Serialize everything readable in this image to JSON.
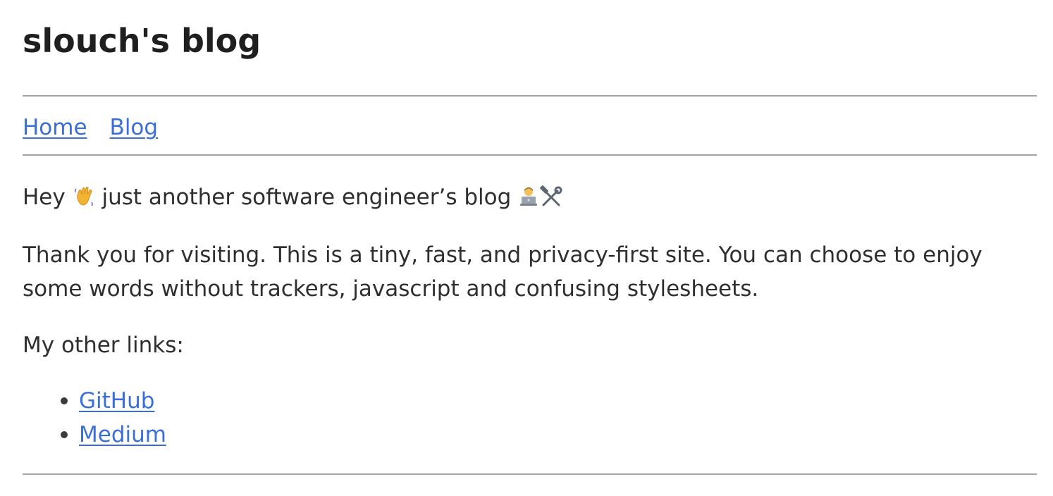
{
  "site": {
    "title": "slouch's blog"
  },
  "nav": {
    "items": [
      {
        "label": "Home"
      },
      {
        "label": "Blog"
      }
    ]
  },
  "content": {
    "intro_prefix": "Hey",
    "intro_wave_icon": "waving-hand-icon",
    "intro_text": "just another software engineer’s blog",
    "intro_icons": [
      "technologist-icon",
      "hammer-and-wrench-icon"
    ],
    "paragraph_line_1": "Thank you for visiting. This is a tiny, fast, and privacy-first site. You can choose to enjoy",
    "paragraph_line_2": "some words without trackers, javascript and confusing stylesheets.",
    "links_label": "My other links:"
  },
  "links": [
    {
      "label": "GitHub"
    },
    {
      "label": "Medium"
    }
  ],
  "colors": {
    "link": "#3a6fd8",
    "text": "#2f2f2f",
    "title": "#1f1f1f",
    "rule": "#a3a3a3"
  }
}
